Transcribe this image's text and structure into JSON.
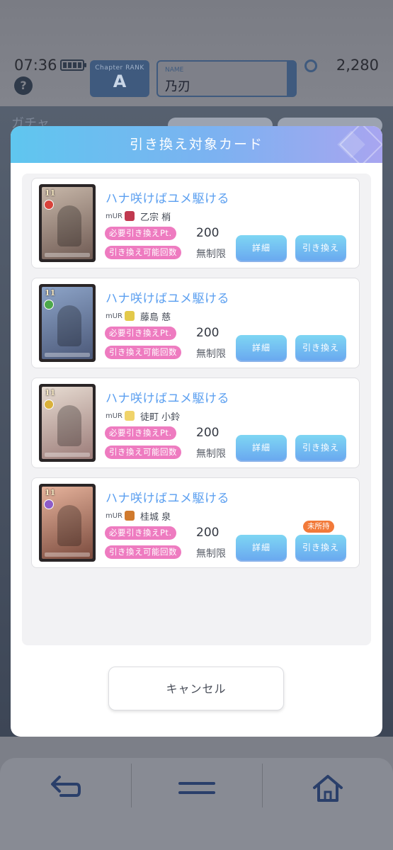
{
  "status": {
    "time": "07:36"
  },
  "header": {
    "rank_label": "Chapter RANK",
    "rank_value": "A",
    "name_label": "NAME",
    "name_value": "乃刃",
    "currency_value": "2,280"
  },
  "background": {
    "title": "ガチャ"
  },
  "modal": {
    "title": "引き換え対象カード",
    "cancel_label": "キャンセル",
    "cards": [
      {
        "title": "ハナ咲けばユメ駆ける",
        "rarity": "mUR",
        "character": "乙宗 梢",
        "cost_label": "必要引き換えPt.",
        "cost_value": "200",
        "limit_label": "引き換え可能回数",
        "limit_value": "無制限",
        "detail_label": "詳細",
        "exchange_label": "引き換え",
        "level": "11",
        "art_colors": [
          "#c7b7a9",
          "#6f5a53"
        ],
        "attr_color": "#d8423a",
        "icon_color": "#c0394f"
      },
      {
        "title": "ハナ咲けばユメ駆ける",
        "rarity": "mUR",
        "character": "藤島 慈",
        "cost_label": "必要引き換えPt.",
        "cost_value": "200",
        "limit_label": "引き換え可能回数",
        "limit_value": "無制限",
        "detail_label": "詳細",
        "exchange_label": "引き換え",
        "level": "11",
        "art_colors": [
          "#8da4c8",
          "#4b5878"
        ],
        "attr_color": "#4ca84a",
        "icon_color": "#e3c94a"
      },
      {
        "title": "ハナ咲けばユメ駆ける",
        "rarity": "mUR",
        "character": "徒町 小鈴",
        "cost_label": "必要引き換えPt.",
        "cost_value": "200",
        "limit_label": "引き換え可能回数",
        "limit_value": "無制限",
        "detail_label": "詳細",
        "exchange_label": "引き換え",
        "level": "11",
        "art_colors": [
          "#e7dcd2",
          "#9b7b78"
        ],
        "attr_color": "#d9b13a",
        "icon_color": "#f0d36a"
      },
      {
        "title": "ハナ咲けばユメ駆ける",
        "rarity": "mUR",
        "character": "桂城 泉",
        "cost_label": "必要引き換えPt.",
        "cost_value": "200",
        "limit_label": "引き換え可能回数",
        "limit_value": "無制限",
        "detail_label": "詳細",
        "exchange_label": "引き換え",
        "badge": "未所持",
        "level": "11",
        "art_colors": [
          "#e6b39c",
          "#7a4a3d"
        ],
        "attr_color": "#8d5cc8",
        "icon_color": "#d07a2d"
      }
    ]
  },
  "colors": {
    "accent": "#5b9ff0",
    "pill": "#ee7bc0",
    "badge": "#f27a3a"
  }
}
